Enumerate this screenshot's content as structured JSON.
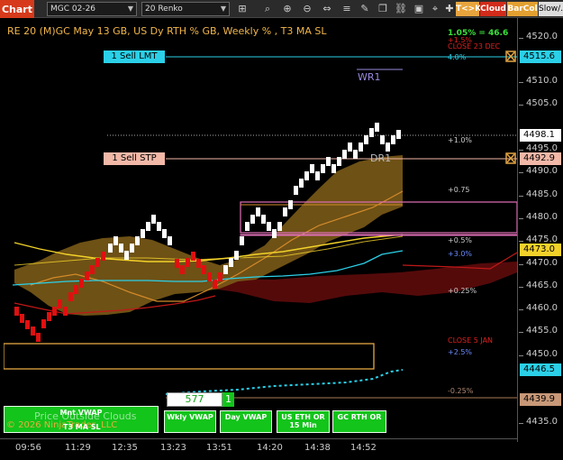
{
  "toolbar": {
    "chart_tab": "Chart",
    "instrument": "MGC 02-26",
    "bar_type": "20 Renko",
    "tk_button": "T<>K",
    "cloud_button": "Cloud",
    "barcol_button": "BarCol",
    "slow_button": "Slow/…",
    "icons": [
      "dropdown-caret-icon",
      "magnifier-icon",
      "zoom-in-icon",
      "zoom-out-icon",
      "bar-spacing-icon",
      "column-width-icon",
      "properties-icon",
      "pencil-icon",
      "duplicate-icon",
      "link-icon",
      "screenshot-icon",
      "chart-trader-icon",
      "crosshair-icon",
      "indicators-icon",
      "strategies-icon"
    ]
  },
  "chart": {
    "title": "RE 20  (M)GC May 13 GB, US Dy RTH % GB, Weekly % , T3 MA SL",
    "sell_limit_label": "1 Sell LMT",
    "sell_stop_label": "1 Sell STP",
    "wr_label": "WR1",
    "dr_label": "DR1",
    "levels": {
      "pct_change": "1.05% = 46.6",
      "pct_1_5": "+1.5%",
      "close_23dec": "CLOSE 23 DEC",
      "pct_4_0": "4.0%",
      "pct_1_0": "+1.0%",
      "pct_0_75": "+0.75",
      "pct_0_5": "+0.5%",
      "pct_3_0": "+3.0%",
      "pct_0_25": "+0.25%",
      "close_5jan": "CLOSE 5 JAN",
      "pct_2_5": "+2.5%",
      "pct_neg_0_25": "-0.25%"
    },
    "price_axis": [
      "4520.0",
      "4510.0",
      "4505.0",
      "4495.0",
      "4490.0",
      "4485.0",
      "4480.0",
      "4475.0",
      "4470.0",
      "4465.0",
      "4460.0",
      "4455.0",
      "4450.0",
      "4435.0"
    ],
    "price_tags": {
      "limit": "4515.6",
      "last": "4498.1",
      "stop": "4492.9",
      "ma": "4473.0",
      "vwap": "4446.5",
      "low": "4439.9"
    },
    "time_axis": [
      "09:56",
      "11:29",
      "12:35",
      "13:23",
      "13:51",
      "14:20",
      "14:38",
      "14:52"
    ]
  },
  "buttons": {
    "mnt_vwap": "Mnt VWAP",
    "t3_ma_sl": "T3 MA SL",
    "wkly_vwap": "Wkly VWAP",
    "day_vwap": "Day VWAP",
    "us_eth": "US ETH OR 15 Min",
    "gc_rth": "GC RTH OR"
  },
  "counter": {
    "value": "577",
    "tab": "1"
  },
  "footer": {
    "copyright": "© 2026 NinjaTrader, LLC",
    "watermark": "Price Outside Clouds"
  },
  "colors": {
    "up_brick": "#ffffff",
    "down_brick": "#e01010",
    "cloud_gold": "#8a6a1c",
    "cloud_red": "#5a0a0a",
    "vwap_cyan": "#2bd0e8",
    "ma_yellow": "#f2d22a",
    "level_pink": "#e070b8",
    "accent_orange": "#e3a642"
  }
}
